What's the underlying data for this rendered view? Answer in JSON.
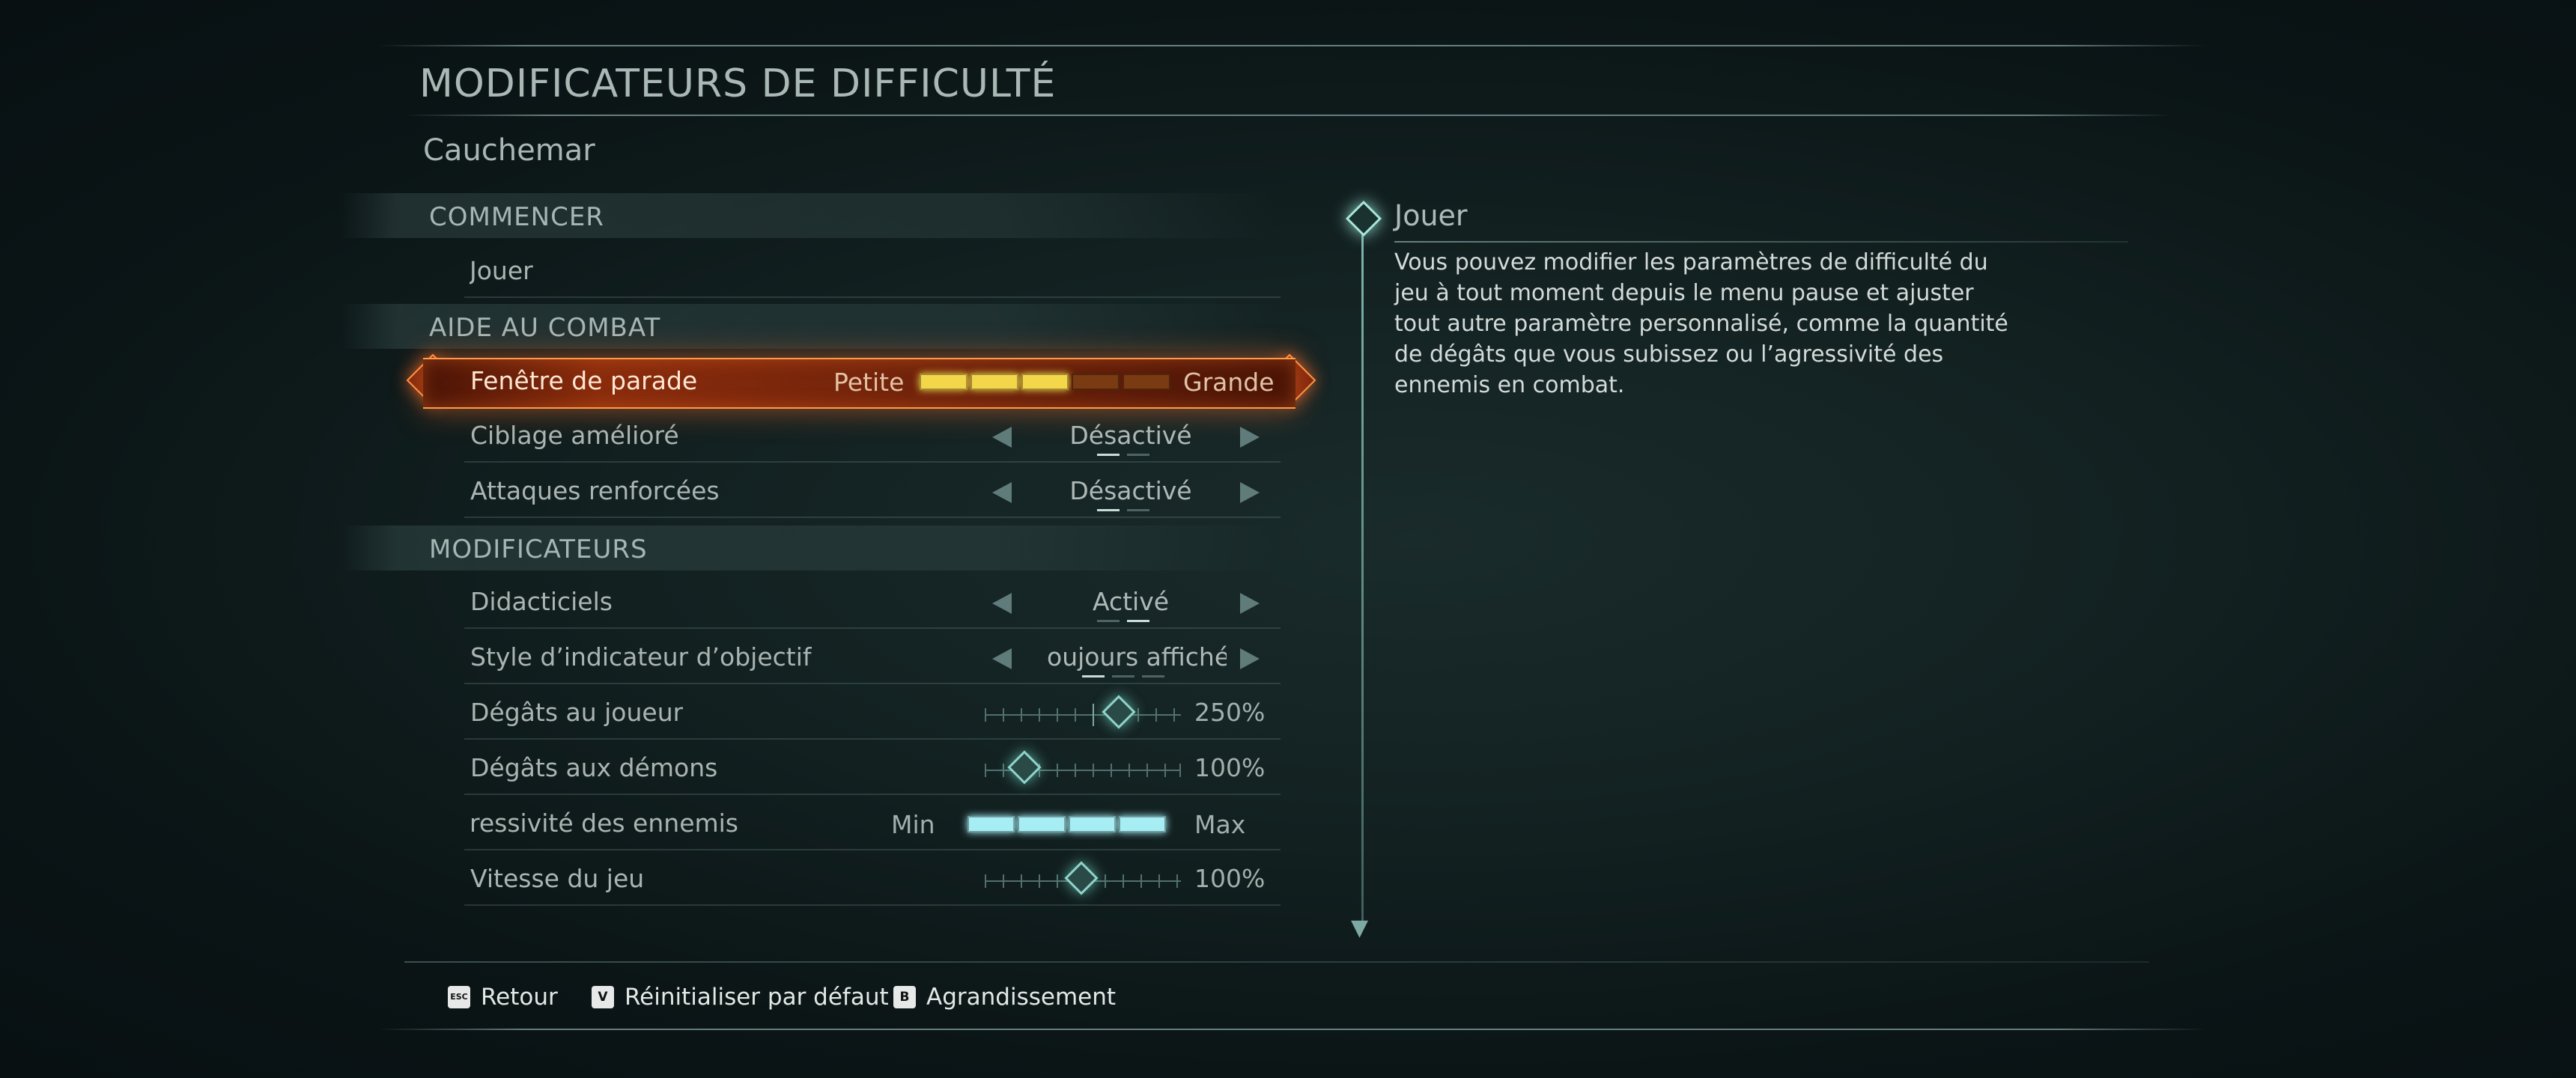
{
  "header": {
    "title": "MODIFICATEURS DE DIFFICULTÉ",
    "subtitle": "Cauchemar"
  },
  "sections": [
    {
      "label": "COMMENCER"
    },
    {
      "label": "AIDE AU COMBAT"
    },
    {
      "label": "MODIFICATEURS"
    }
  ],
  "rows": {
    "play": {
      "label": "Jouer"
    },
    "parry": {
      "label": "Fenêtre de parade",
      "min_label": "Petite",
      "max_label": "Grande",
      "level": 3,
      "max_level": 5
    },
    "targeting": {
      "label": "Ciblage amélioré",
      "value": "Désactivé"
    },
    "attacks": {
      "label": "Attaques renforcées",
      "value": "Désactivé"
    },
    "tutorials": {
      "label": "Didacticiels",
      "value": "Activé"
    },
    "objective": {
      "label": "Style d’indicateur d’objectif",
      "value": "oujours affiché"
    },
    "player_damage": {
      "label": "Dégâts au joueur",
      "value": "250%"
    },
    "demon_damage": {
      "label": "Dégâts aux démons",
      "value": "100%"
    },
    "aggression": {
      "label": "ressivité des ennemis",
      "min_label": "Min",
      "max_label": "Max",
      "level": 4,
      "max_level": 4
    },
    "game_speed": {
      "label": "Vitesse du jeu",
      "value": "100%"
    }
  },
  "info": {
    "title": "Jouer",
    "body": "Vous pouvez modifier les paramètres de difficulté du jeu à tout moment depuis le menu pause et ajuster tout autre paramètre personnalisé, comme la quantité de dégâts que vous subissez ou l’agressivité des ennemis en combat."
  },
  "footer": {
    "back": {
      "key": "ESC",
      "label": "Retour"
    },
    "reset": {
      "key": "V",
      "label": "Réinitialiser par défaut"
    },
    "zoom": {
      "key": "B",
      "label": "Agrandissement"
    }
  },
  "colors": {
    "accent_orange": "#ff9a48",
    "slider_teal": "#8fd3c9",
    "bar_yellow": "#f3d64a",
    "bar_cyan": "#a6eef3"
  }
}
